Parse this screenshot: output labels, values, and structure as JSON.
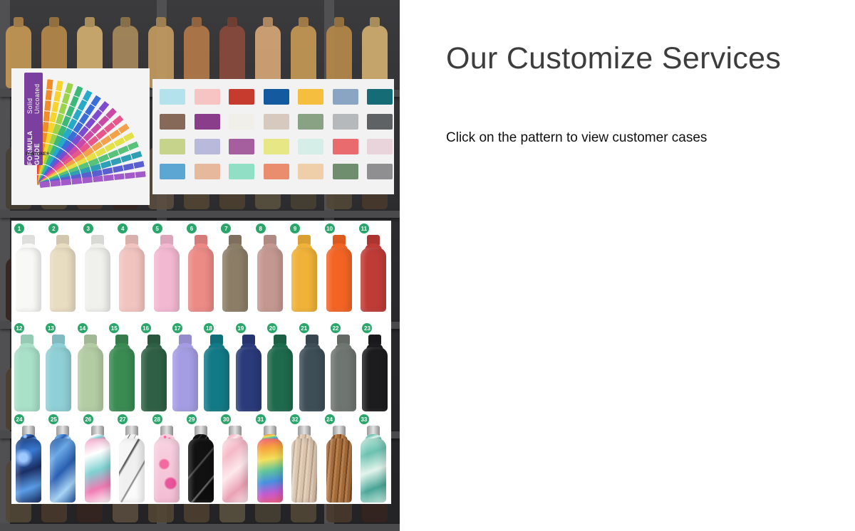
{
  "page": {
    "title": "Our Customize Services",
    "subtitle": "Click on the pattern to view customer cases"
  },
  "pantone": {
    "guide_title": "FORMULA GUIDE",
    "guide_subtitle": "Solid Uncoated",
    "logo": "PANTONE®"
  },
  "swatches": [
    "#b3e1ec",
    "#f6c4c3",
    "#c53b2e",
    "#145a9f",
    "#f5be3f",
    "#8aa5c3",
    "#166c76",
    "#87695a",
    "#8a3d8b",
    "#f1efea",
    "#d6cabe",
    "#8aa284",
    "#b5b9bb",
    "#5e6264",
    "#c6d48b",
    "#b8b9db",
    "#a55f9e",
    "#e8e785",
    "#d5efe8",
    "#e96b6d",
    "#ead4dc",
    "#5ba6d2",
    "#e6b99c",
    "#91dfc4",
    "#e98d6e",
    "#efcfaa",
    "#6f8e6e",
    "#8f8f92"
  ],
  "bottles": [
    {
      "num": "1",
      "color": "#f8f8f6"
    },
    {
      "num": "2",
      "color": "#e8dcc1"
    },
    {
      "num": "3",
      "color": "#f0f0ec"
    },
    {
      "num": "4",
      "color": "#f2c4c0"
    },
    {
      "num": "5",
      "color": "#f3b8d1"
    },
    {
      "num": "6",
      "color": "#ec8a86"
    },
    {
      "num": "7",
      "color": "#8c7d67"
    },
    {
      "num": "8",
      "color": "#c49890"
    },
    {
      "num": "9",
      "color": "#f0b238"
    },
    {
      "num": "10",
      "color": "#f36424"
    },
    {
      "num": "11",
      "color": "#bf3b36"
    },
    {
      "num": "12",
      "color": "#a8e0c8"
    },
    {
      "num": "13",
      "color": "#8fd0d6"
    },
    {
      "num": "14",
      "color": "#b3cca4"
    },
    {
      "num": "15",
      "color": "#3a8b52"
    },
    {
      "num": "16",
      "color": "#2f6045"
    },
    {
      "num": "17",
      "color": "#a49de3"
    },
    {
      "num": "18",
      "color": "#127a86"
    },
    {
      "num": "19",
      "color": "#2a3a7a"
    },
    {
      "num": "20",
      "color": "#1e6a4d"
    },
    {
      "num": "21",
      "color": "#3d4e57"
    },
    {
      "num": "22",
      "color": "#6f7570"
    },
    {
      "num": "23",
      "color": "#1c1c1e"
    },
    {
      "num": "24",
      "color": "#2f5fa6",
      "pattern": "galaxy"
    },
    {
      "num": "25",
      "color": "#3d73b5",
      "pattern": "marble-blue"
    },
    {
      "num": "26",
      "color": "#e7a2c7",
      "pattern": "pink-teal"
    },
    {
      "num": "27",
      "color": "#ebebeb",
      "pattern": "marble-white"
    },
    {
      "num": "28",
      "color": "#f2bfd0",
      "pattern": "floral"
    },
    {
      "num": "29",
      "color": "#1b1b1b",
      "pattern": "black-marble"
    },
    {
      "num": "30",
      "color": "#f5d3d9",
      "pattern": "pink-marble"
    },
    {
      "num": "31",
      "color": "#e66f8b",
      "pattern": "rainbow"
    },
    {
      "num": "32",
      "color": "#cdb7a0",
      "pattern": "wood-light"
    },
    {
      "num": "24",
      "color": "#9a6335",
      "pattern": "wood-dark"
    },
    {
      "num": "33",
      "color": "#9ed6c9",
      "pattern": "sea"
    }
  ]
}
